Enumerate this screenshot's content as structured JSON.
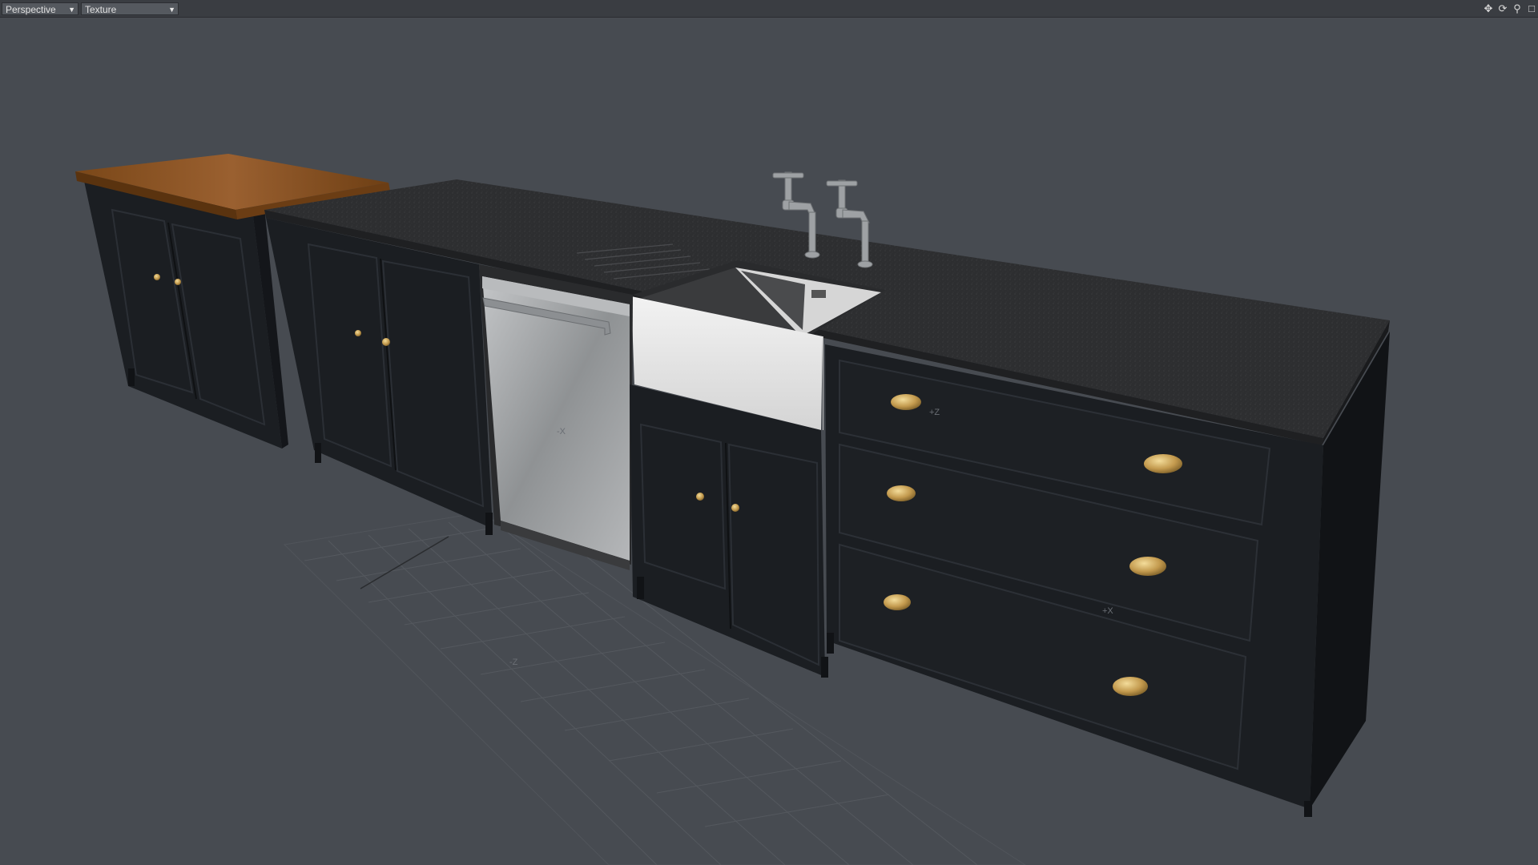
{
  "toolbar": {
    "view_mode": "Perspective",
    "shading_mode": "Texture",
    "icons": [
      "move-view-icon",
      "rotate-view-icon",
      "zoom-view-icon",
      "maximize-view-icon"
    ]
  },
  "scene": {
    "axis_labels": {
      "z_label": "-Z",
      "x_label_dishwasher": "-X",
      "x_label_drawer": "+X",
      "z_label_drawer": "+Z"
    }
  },
  "colors": {
    "background": "#474b51",
    "cabinet": "#1c1f23",
    "worktop": "#2e2f31",
    "oak": "#8a5323",
    "brass": "#c9a25a",
    "steel": "#a9abad",
    "ceramic": "#e8e8e8"
  }
}
